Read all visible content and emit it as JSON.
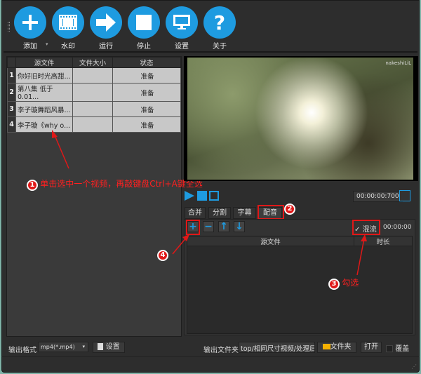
{
  "toolbar": {
    "items": [
      {
        "label": "添加",
        "icon": "plus-icon"
      },
      {
        "label": "水印",
        "icon": "film-icon"
      },
      {
        "label": "运行",
        "icon": "arrow-right-icon"
      },
      {
        "label": "停止",
        "icon": "stop-icon"
      },
      {
        "label": "设置",
        "icon": "monitor-icon"
      },
      {
        "label": "关于",
        "icon": "question-icon"
      }
    ],
    "accent": "#1e9be0"
  },
  "file_table": {
    "headers": [
      "源文件",
      "文件大小",
      "状态"
    ],
    "rows": [
      {
        "index": "1",
        "name": "你好旧时光高甜...",
        "size": "",
        "status": "准备"
      },
      {
        "index": "2",
        "name": "第八集 低于0.01...",
        "size": "",
        "status": "准备"
      },
      {
        "index": "3",
        "name": "李子璇舞蹈风暴...",
        "size": "",
        "status": "准备"
      },
      {
        "index": "4",
        "name": "李子璇《why o...",
        "size": "",
        "status": "准备"
      }
    ]
  },
  "preview": {
    "watermark": "nakeshiLiL",
    "time": "00:00:00:700"
  },
  "tabs": [
    {
      "label": "合并"
    },
    {
      "label": "分割"
    },
    {
      "label": "字幕"
    },
    {
      "label": "配音",
      "active": true
    }
  ],
  "dubbing": {
    "mix_label": "混流",
    "mix_checked": true,
    "time": "00:00:00",
    "headers": [
      "源文件",
      "时长"
    ]
  },
  "annotations": {
    "step1": "单击选中一个视频，再敲键盘Ctrl+A键全选",
    "n1": "1",
    "n2": "2",
    "n3": "3",
    "n4": "4",
    "step3": "勾选"
  },
  "bottom": {
    "format_label": "输出格式",
    "format_value": "mp4(*.mp4)",
    "settings": "设置",
    "folder_label": "输出文件夹",
    "folder_value": "top/相同尺寸视频/处理后",
    "folder_btn": "文件夹",
    "open": "打开",
    "overwrite": "覆盖"
  }
}
